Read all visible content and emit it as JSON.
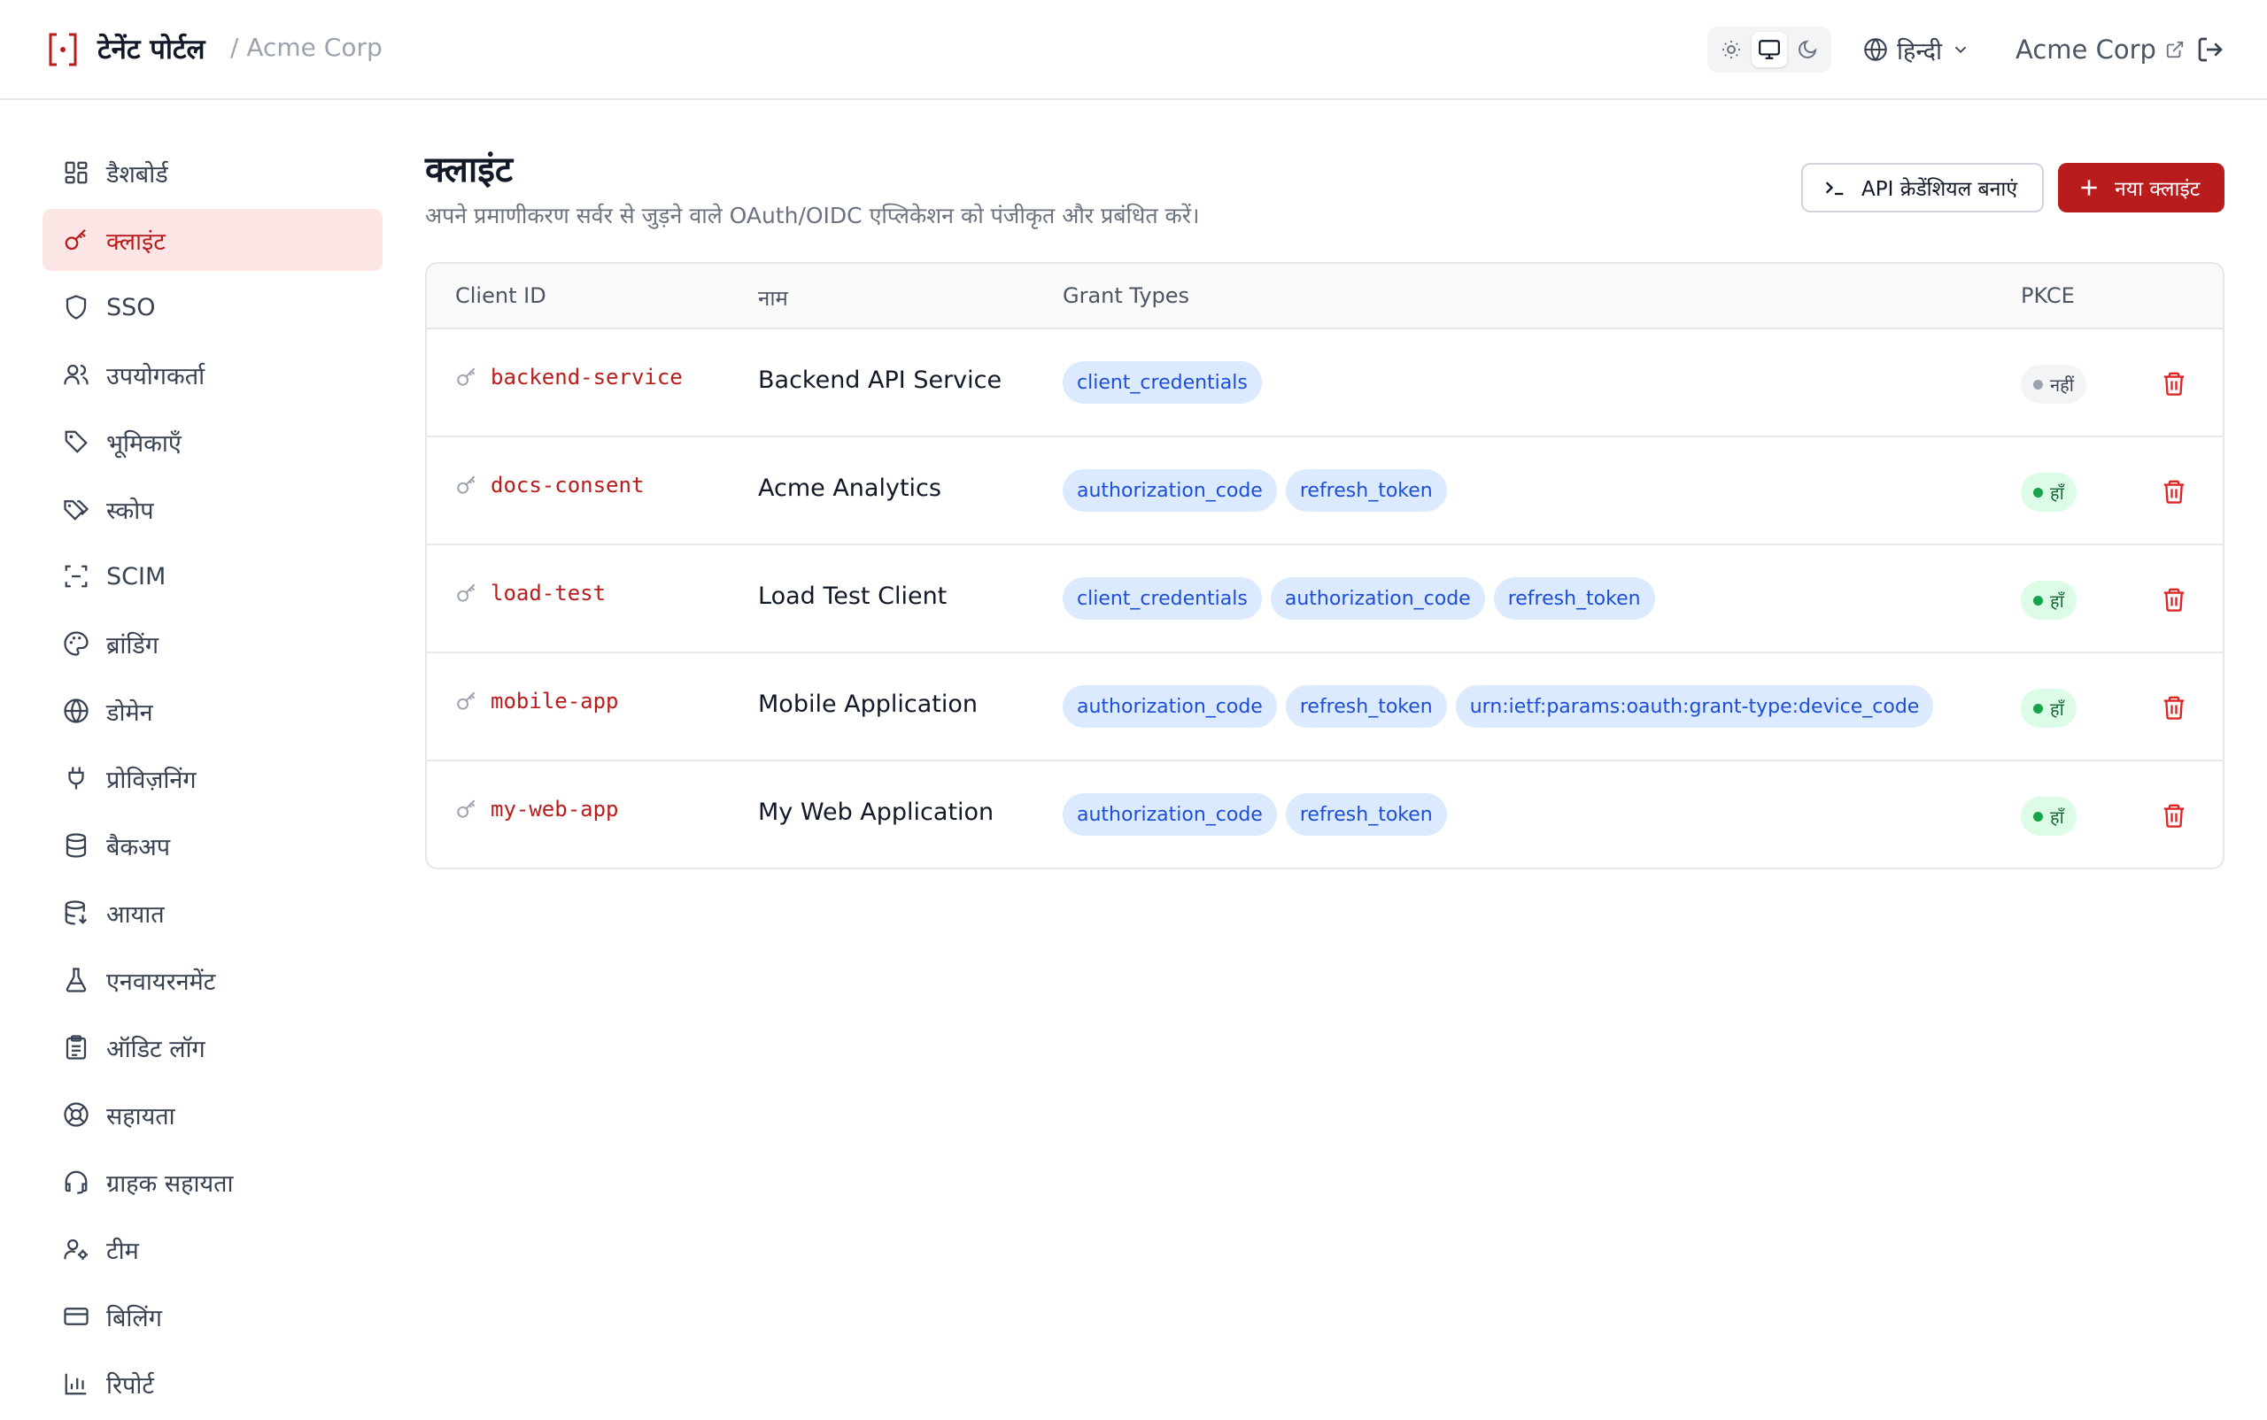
{
  "header": {
    "brand_name": "टेनेंट पोर्टल",
    "tenant_crumb": "/ Acme Corp",
    "language": "हिन्दी",
    "tenant_link": "Acme Corp",
    "accent_color": "#b91c1c"
  },
  "sidebar": {
    "items": [
      {
        "label": "डैशबोर्ड",
        "icon": "dashboard-icon",
        "active": false
      },
      {
        "label": "क्लाइंट",
        "icon": "key-icon",
        "active": true
      },
      {
        "label": "SSO",
        "icon": "shield-icon",
        "active": false
      },
      {
        "label": "उपयोगकर्ता",
        "icon": "users-icon",
        "active": false
      },
      {
        "label": "भूमिकाएँ",
        "icon": "tag-icon",
        "active": false
      },
      {
        "label": "स्कोप",
        "icon": "tags-icon",
        "active": false
      },
      {
        "label": "SCIM",
        "icon": "scan-icon",
        "active": false
      },
      {
        "label": "ब्रांडिंग",
        "icon": "palette-icon",
        "active": false
      },
      {
        "label": "डोमेन",
        "icon": "globe-icon",
        "active": false
      },
      {
        "label": "प्रोविज़निंग",
        "icon": "plug-icon",
        "active": false
      },
      {
        "label": "बैकअप",
        "icon": "database-icon",
        "active": false
      },
      {
        "label": "आयात",
        "icon": "database-import-icon",
        "active": false
      },
      {
        "label": "एनवायरनमेंट",
        "icon": "flask-icon",
        "active": false
      },
      {
        "label": "ऑडिट लॉग",
        "icon": "clipboard-icon",
        "active": false
      },
      {
        "label": "सहायता",
        "icon": "lifebuoy-icon",
        "active": false
      },
      {
        "label": "ग्राहक सहायता",
        "icon": "headset-icon",
        "active": false
      },
      {
        "label": "टीम",
        "icon": "user-gear-icon",
        "active": false
      },
      {
        "label": "बिलिंग",
        "icon": "credit-card-icon",
        "active": false
      },
      {
        "label": "रिपोर्ट",
        "icon": "bar-chart-icon",
        "active": false
      }
    ]
  },
  "main": {
    "title": "क्लाइंट",
    "subtitle": "अपने प्रमाणीकरण सर्वर से जुड़ने वाले OAuth/OIDC एप्लिकेशन को पंजीकृत और प्रबंधित करें।",
    "api_button_label": "API क्रेडेंशियल बनाएं",
    "new_client_label": "नया क्लाइंट"
  },
  "table": {
    "columns": [
      "Client ID",
      "नाम",
      "Grant Types",
      "PKCE"
    ],
    "rows": [
      {
        "client_id": "backend-service",
        "name": "Backend API Service",
        "grants": [
          "client_credentials"
        ],
        "pkce": "नहीं",
        "pkce_enabled": false
      },
      {
        "client_id": "docs-consent",
        "name": "Acme Analytics",
        "grants": [
          "authorization_code",
          "refresh_token"
        ],
        "pkce": "हाँ",
        "pkce_enabled": true
      },
      {
        "client_id": "load-test",
        "name": "Load Test Client",
        "grants": [
          "client_credentials",
          "authorization_code",
          "refresh_token"
        ],
        "pkce": "हाँ",
        "pkce_enabled": true
      },
      {
        "client_id": "mobile-app",
        "name": "Mobile Application",
        "grants": [
          "authorization_code",
          "refresh_token",
          "urn:ietf:params:oauth:grant-type:device_code"
        ],
        "pkce": "हाँ",
        "pkce_enabled": true
      },
      {
        "client_id": "my-web-app",
        "name": "My Web Application",
        "grants": [
          "authorization_code",
          "refresh_token"
        ],
        "pkce": "हाँ",
        "pkce_enabled": true
      }
    ]
  }
}
